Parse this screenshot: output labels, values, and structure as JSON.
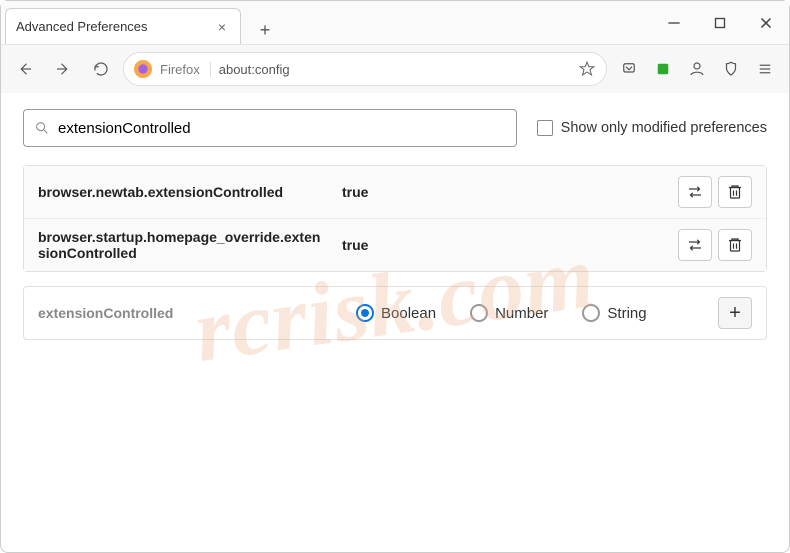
{
  "window": {
    "tab_title": "Advanced Preferences"
  },
  "urlbar": {
    "identity": "Firefox",
    "address": "about:config"
  },
  "search": {
    "value": "extensionControlled"
  },
  "checkbox": {
    "label": "Show only modified preferences"
  },
  "results": [
    {
      "name": "browser.newtab.extensionControlled",
      "value": "true"
    },
    {
      "name": "browser.startup.homepage_override.extensionControlled",
      "value": "true"
    }
  ],
  "new_pref": {
    "name": "extensionControlled",
    "types": [
      "Boolean",
      "Number",
      "String"
    ],
    "selected": "Boolean"
  },
  "watermark": "rcrisk.com"
}
